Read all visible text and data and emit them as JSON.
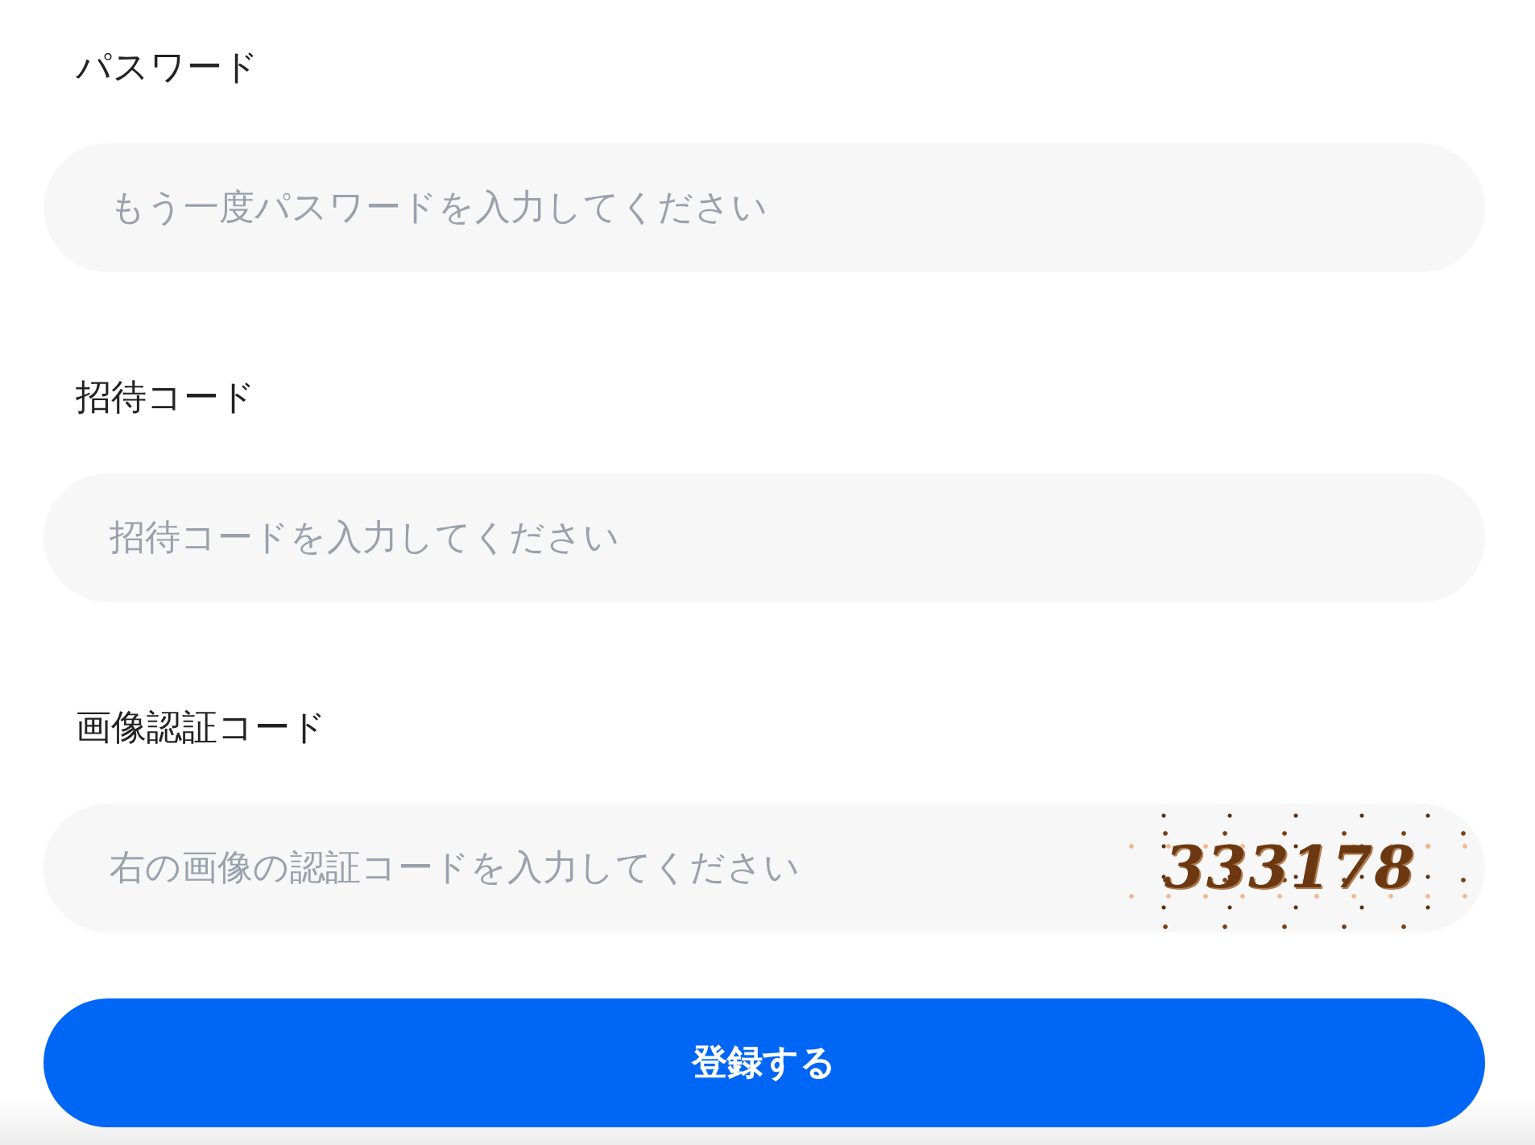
{
  "fields": [
    {
      "kind": "text",
      "label": "パスワード",
      "placeholder": "もう一度パスワードを入力してください"
    },
    {
      "kind": "text",
      "label": "招待コード",
      "placeholder": "招待コードを入力してください"
    },
    {
      "kind": "captcha",
      "label": "画像認証コード",
      "placeholder": "右の画像の認証コードを入力してください",
      "captcha": "333178"
    }
  ],
  "submit_button": {
    "label": "登録する"
  }
}
